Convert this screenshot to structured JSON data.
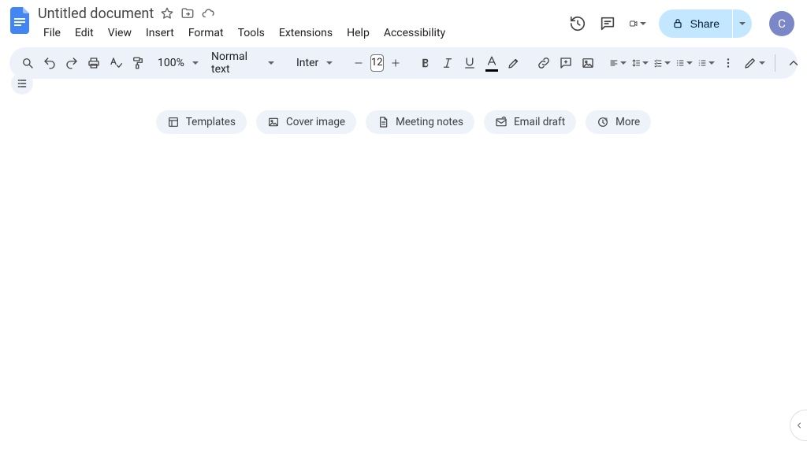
{
  "header": {
    "title": "Untitled document",
    "menus": [
      "File",
      "Edit",
      "View",
      "Insert",
      "Format",
      "Tools",
      "Extensions",
      "Help",
      "Accessibility"
    ],
    "share_label": "Share",
    "avatar_initial": "C"
  },
  "toolbar": {
    "zoom": "100%",
    "style": "Normal text",
    "font": "Inter",
    "font_size": "12"
  },
  "chips": {
    "templates": "Templates",
    "cover_image": "Cover image",
    "meeting_notes": "Meeting notes",
    "email_draft": "Email draft",
    "more": "More"
  }
}
